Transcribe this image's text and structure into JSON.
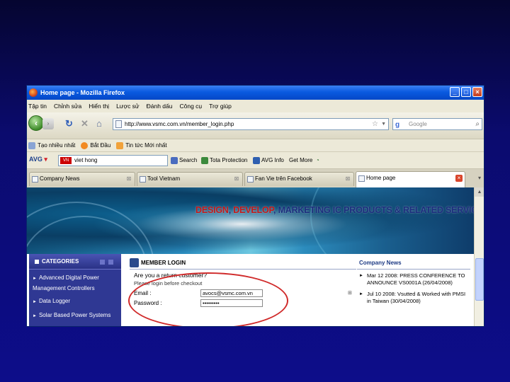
{
  "window": {
    "title": "Home page - Mozilla Firefox"
  },
  "menu": [
    "Tập tin",
    "Chỉnh sửa",
    "Hiển thị",
    "Lược sử",
    "Đánh dấu",
    "Công cụ",
    "Trợ giúp"
  ],
  "nav": {
    "back_icon": "back-arrow-icon",
    "url": "http://www.vsmc.com.vn/member_login.php",
    "search_placeholder": "Google"
  },
  "bookmarks": [
    "Tạo nhiều nhất",
    "Bắt Đầu",
    "Tin tức Mới nhất"
  ],
  "avg": {
    "logo": "AVG",
    "flag": "VN",
    "search_value": "viet hong",
    "buttons": [
      "Search",
      "Tota Protection",
      "AVG Info",
      "Get More"
    ]
  },
  "tabs": [
    {
      "label": "Company News",
      "active": false
    },
    {
      "label": "Tool Vietnam",
      "active": false
    },
    {
      "label": "Fan Vie trên Facebook",
      "active": false
    },
    {
      "label": "Home page",
      "active": true
    }
  ],
  "banner": {
    "part1": "DESIGN",
    "sep1": ", ",
    "part2": "DEVELOP",
    "sep2": ", ",
    "part3": "MARKETING IC PRODUCTS & RELATED SERVICES"
  },
  "categories": {
    "title": "CATEGORIES",
    "items": [
      "Advanced Digital Power Management Controllers",
      "Data Logger",
      "Solar Based Power Systems"
    ]
  },
  "login": {
    "title": "MEMBER LOGIN",
    "question": "Are you a return customer?",
    "subtitle": "Please login before checkout",
    "email_label": "Email :",
    "email_value": "avocs@vsmc.com.vn",
    "password_label": "Password :",
    "password_value": "•••••••••",
    "email_marker": "⊞"
  },
  "news": {
    "title": "Company News",
    "items": [
      "Mar 12 2008: PRESS CONFERENCE TO ANNOUNCE VS0001A (26/04/2008)",
      "Jul 10 2008: Vsutted & Worked with PMSI in Taiwan (30/04/2008)"
    ]
  },
  "colors": {
    "slide_bg": "#0d0d8a",
    "accent_red": "#c41a1a",
    "brand_blue": "#1d2f7e",
    "category_bg": "#2f3893",
    "highlight_ellipse": "#d02a2a"
  }
}
